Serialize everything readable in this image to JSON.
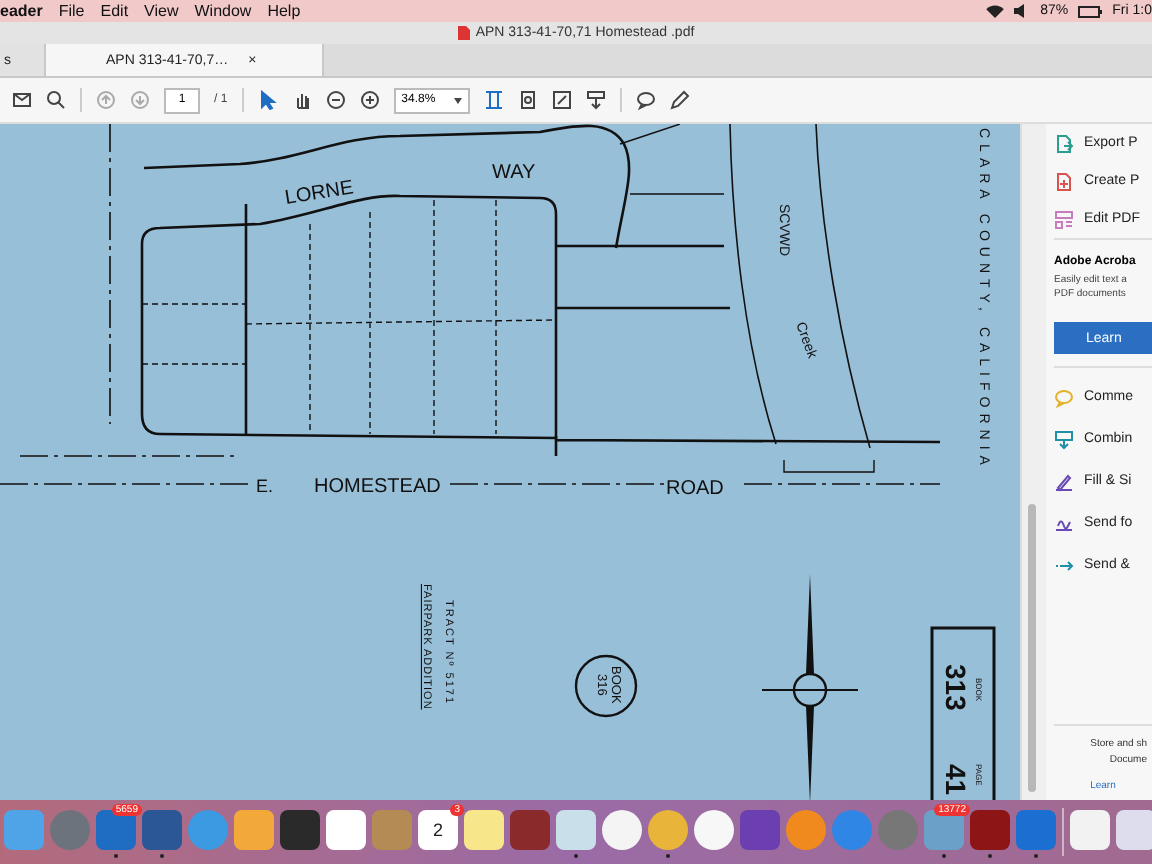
{
  "menu_bar": {
    "app": "eader",
    "items": [
      "File",
      "Edit",
      "View",
      "Window",
      "Help"
    ],
    "battery": "87%",
    "clock": "Fri 1:0"
  },
  "window": {
    "title": "APN 313-41-70,71 Homestead .pdf"
  },
  "tabs": [
    {
      "label": "s",
      "selected": false
    },
    {
      "label": "APN 313-41-70,7…",
      "selected": true,
      "close": "×"
    }
  ],
  "toolbar": {
    "page": "1",
    "page_count": "/ 1",
    "zoom": "34.8%"
  },
  "map": {
    "street_1": "LORNE",
    "street_2": "WAY",
    "road_1": "E.",
    "road_2": "HOMESTEAD",
    "road_3": "ROAD",
    "district": "SCVWD",
    "creek": "Creek",
    "county": "CLARA   COUNTY,   CALIFORNIA",
    "tract": "TRACT Nº 5171",
    "addition": "FAIRPARK ADDITION",
    "circle_book": "BOOK",
    "circle_number": "316",
    "box_book": "BOOK",
    "box_book_number": "313",
    "box_page": "PAGE",
    "box_page_number": "41"
  },
  "tools_panel": {
    "top_items": [
      {
        "label": "Export P",
        "kind": "export"
      },
      {
        "label": "Create P",
        "kind": "create"
      },
      {
        "label": "Edit PDF",
        "kind": "edit"
      }
    ],
    "promo": {
      "title": "Adobe Acroba",
      "text": "Easily edit text a PDF documents",
      "button": "Learn"
    },
    "items": [
      {
        "label": "Comme",
        "kind": "comment"
      },
      {
        "label": "Combin",
        "kind": "combine"
      },
      {
        "label": "Fill & Si",
        "kind": "fill"
      },
      {
        "label": "Send fo",
        "kind": "sign"
      },
      {
        "label": "Send &",
        "kind": "send"
      }
    ],
    "footer": {
      "text": "Store and sh Docume",
      "link": "Learn"
    }
  },
  "dock": [
    {
      "kind": "finder",
      "running": false
    },
    {
      "kind": "launchpad",
      "running": false
    },
    {
      "kind": "outlook",
      "running": true,
      "badge": "5659"
    },
    {
      "kind": "word",
      "running": true
    },
    {
      "kind": "safari",
      "running": false
    },
    {
      "kind": "pages",
      "running": false
    },
    {
      "kind": "keynote",
      "running": false
    },
    {
      "kind": "numbers",
      "running": false
    },
    {
      "kind": "contacts",
      "running": false
    },
    {
      "kind": "calendar",
      "running": false,
      "badge": "3",
      "date": "2"
    },
    {
      "kind": "notes",
      "running": false
    },
    {
      "kind": "photobooth",
      "running": false
    },
    {
      "kind": "preview",
      "running": true
    },
    {
      "kind": "music",
      "running": false
    },
    {
      "kind": "chrome",
      "running": true
    },
    {
      "kind": "photos",
      "running": false
    },
    {
      "kind": "imovie",
      "running": false
    },
    {
      "kind": "books",
      "running": false
    },
    {
      "kind": "appstore",
      "running": false
    },
    {
      "kind": "settings",
      "running": false
    },
    {
      "kind": "iphoto",
      "running": true,
      "badge": "13772"
    },
    {
      "kind": "acrobat",
      "running": true
    },
    {
      "kind": "teamviewer",
      "running": true
    },
    {
      "kind": "separator"
    },
    {
      "kind": "document",
      "running": false
    },
    {
      "kind": "trash",
      "running": false
    }
  ]
}
